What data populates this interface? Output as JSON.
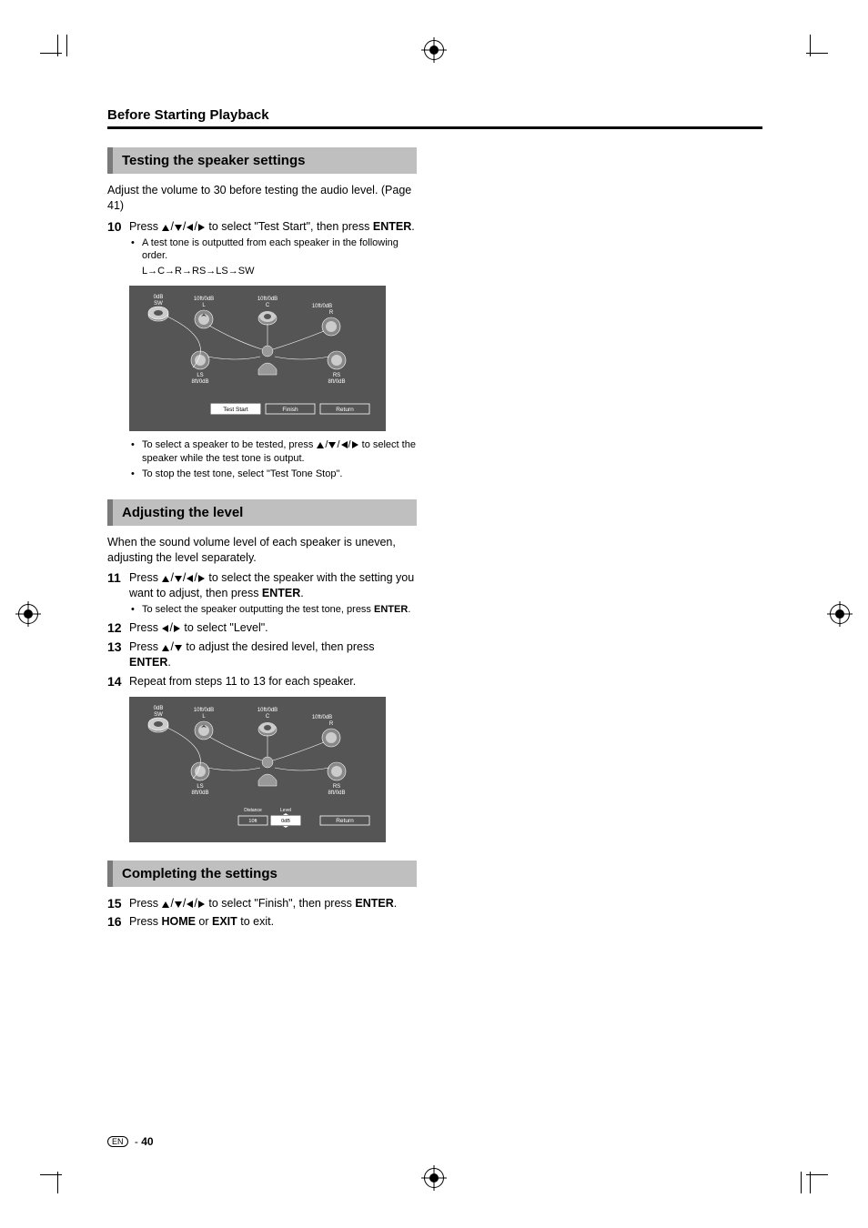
{
  "sectionTitle": "Before Starting Playback",
  "heads": {
    "testing": "Testing the speaker settings",
    "adjusting": "Adjusting the level",
    "completing": "Completing the settings"
  },
  "intro1": "Adjust the volume to 30 before testing the audio level. (Page 41)",
  "step10": {
    "num": "10",
    "text_a": "Press ",
    "text_b": " to select \"Test Start\", then press ",
    "enter": "ENTER",
    "text_c": "."
  },
  "step10_sub1": "A test tone is outputted from each speaker in the following order.",
  "step10_chain": "L→C→R→RS→LS→SW",
  "step10_sub2a": "To select a speaker to be tested, press ",
  "step10_sub2b": " to select the speaker while the test tone is output.",
  "step10_sub3": "To stop the test tone, select \"Test Tone Stop\".",
  "intro2": "When the sound volume level of each speaker is uneven, adjusting the level separately.",
  "step11": {
    "num": "11",
    "text_a": "Press ",
    "text_b": " to select the speaker with the setting you want to adjust, then press ",
    "enter": "ENTER",
    "text_c": "."
  },
  "step11_sub": "To select the speaker outputting the test tone, press ",
  "step11_sub_enter": "ENTER",
  "step11_sub_end": ".",
  "step12": {
    "num": "12",
    "text_a": "Press ",
    "text_b": " to select \"Level\"."
  },
  "step13": {
    "num": "13",
    "text_a": "Press ",
    "text_b": " to adjust the desired level, then press ",
    "enter": "ENTER",
    "text_c": "."
  },
  "step14": {
    "num": "14",
    "text": "Repeat from steps 11 to 13 for each speaker."
  },
  "step15": {
    "num": "15",
    "text_a": "Press ",
    "text_b": " to select \"Finish\", then press ",
    "enter": "ENTER",
    "text_c": "."
  },
  "step16": {
    "num": "16",
    "text_a": "Press ",
    "home": "HOME",
    "text_b": " or ",
    "exit": "EXIT",
    "text_c": " to exit."
  },
  "diag": {
    "sw": "0dB",
    "sw_lbl": "SW",
    "l": "10ft/0dB",
    "l_lbl": "L",
    "c": "10ft/0dB",
    "c_lbl": "C",
    "r": "10ft/0dB",
    "r_lbl": "R",
    "ls": "LS",
    "ls_val": "8ft/0dB",
    "rs": "RS",
    "rs_val": "8ft/0dB",
    "btn_test": "Test Start",
    "btn_finish": "Finish",
    "btn_return": "Return",
    "distance": "Distance",
    "level": "Level",
    "dist_val": "10ft",
    "level_val": "0dB"
  },
  "footer": {
    "en": "EN",
    "sep": " - ",
    "page": "40"
  }
}
